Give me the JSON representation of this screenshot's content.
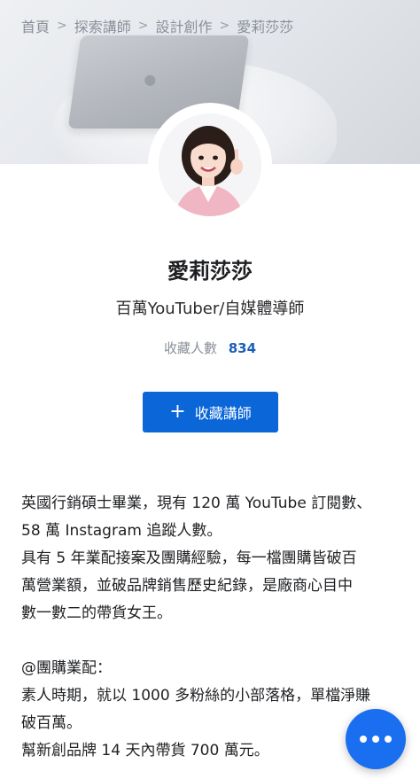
{
  "breadcrumb": {
    "items": [
      "首頁",
      "探索講師",
      "設計創作",
      "愛莉莎莎"
    ]
  },
  "profile": {
    "name": "愛莉莎莎",
    "title": "百萬YouTuber/自媒體導師",
    "favorites_label": "收藏人數",
    "favorites_count": "834",
    "favorite_button": "收藏講師"
  },
  "bio": {
    "lines": [
      "英國行銷碩士畢業，現有 120 萬 YouTube 訂閱數、",
      "58 萬 Instagram 追蹤人數。",
      "具有 5 年業配接案及團購經驗，每一檔團購皆破百",
      "萬營業額，並破品牌銷售歷史紀錄，是廠商心目中",
      "數一數二的帶貨女王。",
      "",
      "@團購業配：",
      "素人時期，就以 1000 多粉絲的小部落格，單檔淨賺",
      "破百萬。",
      "幫新創品牌 14 天內帶貨 700 萬元。"
    ]
  },
  "icons": {
    "breadcrumb_separator": "chevron-right-icon",
    "favorite_button_icon": "plus-icon",
    "chat_button_icon": "more-dots-icon"
  },
  "colors": {
    "accent": "#0b66d8",
    "count": "#1c5fb8",
    "chat": "#1a6ff0"
  }
}
